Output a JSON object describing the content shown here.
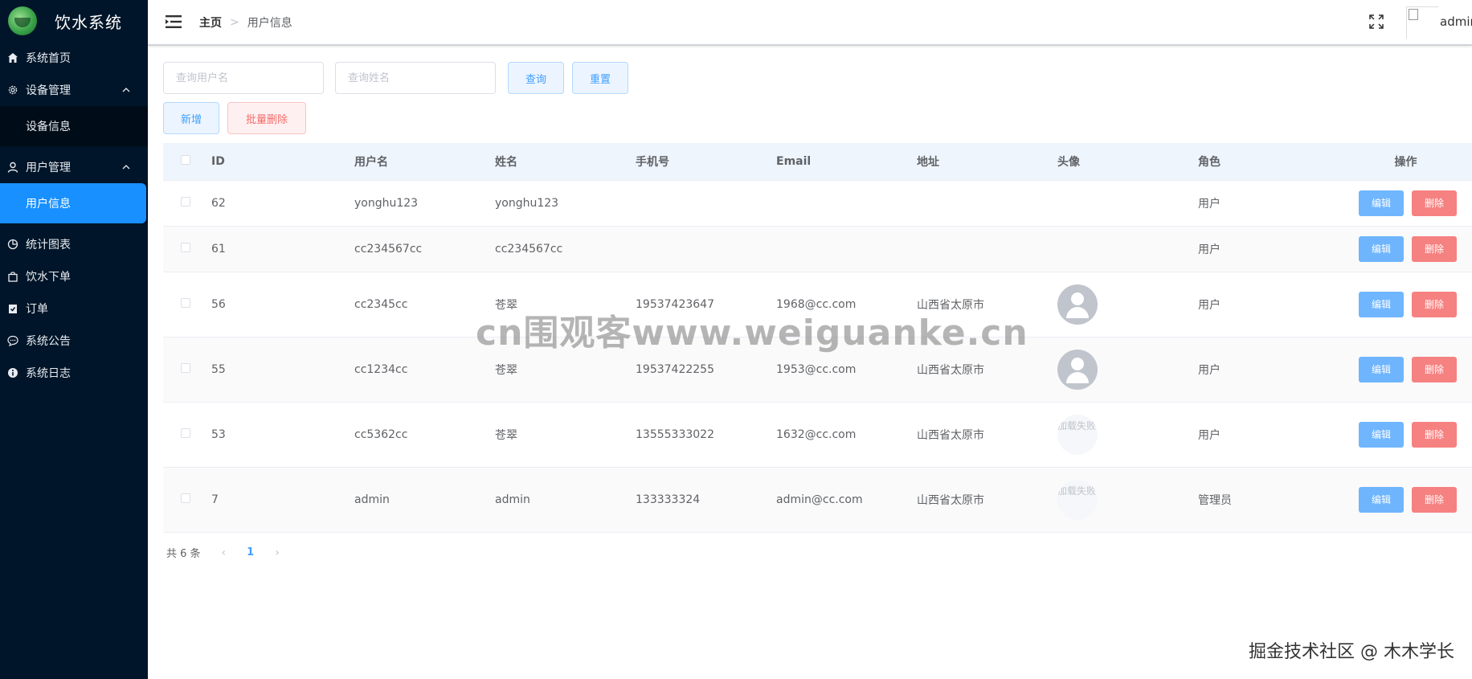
{
  "app": {
    "title": "饮水系统"
  },
  "sidebar": {
    "items": [
      {
        "label": "系统首页",
        "icon": "home-icon"
      },
      {
        "label": "设备管理",
        "icon": "gear-icon",
        "expanded": true,
        "children": [
          {
            "label": "设备信息"
          }
        ]
      },
      {
        "label": "用户管理",
        "icon": "user-icon",
        "expanded": true,
        "children": [
          {
            "label": "用户信息",
            "active": true
          }
        ]
      },
      {
        "label": "统计图表",
        "icon": "pie-chart-icon"
      },
      {
        "label": "饮水下单",
        "icon": "shopping-bag-icon"
      },
      {
        "label": "订单",
        "icon": "clipboard-check-icon"
      },
      {
        "label": "系统公告",
        "icon": "chat-bubble-icon"
      },
      {
        "label": "系统日志",
        "icon": "info-icon"
      }
    ]
  },
  "header": {
    "breadcrumb": {
      "home": "主页",
      "separator": ">",
      "current": "用户信息"
    },
    "user": "admin"
  },
  "search": {
    "username_placeholder": "查询用户名",
    "name_placeholder": "查询姓名",
    "query_label": "查询",
    "reset_label": "重置"
  },
  "actions": {
    "add_label": "新增",
    "batch_delete_label": "批量删除"
  },
  "table": {
    "columns": {
      "id": "ID",
      "username": "用户名",
      "name": "姓名",
      "phone": "手机号",
      "email": "Email",
      "address": "地址",
      "avatar": "头像",
      "role": "角色",
      "ops": "操作"
    },
    "edit_label": "编辑",
    "delete_label": "删除",
    "avatar_failed_text": "加载失败",
    "rows": [
      {
        "id": "62",
        "username": "yonghu123",
        "name": "yonghu123",
        "phone": "",
        "email": "",
        "address": "",
        "avatar": "none",
        "role": "用户"
      },
      {
        "id": "61",
        "username": "cc234567cc",
        "name": "cc234567cc",
        "phone": "",
        "email": "",
        "address": "",
        "avatar": "none",
        "role": "用户"
      },
      {
        "id": "56",
        "username": "cc2345cc",
        "name": "苍翠",
        "phone": "19537423647",
        "email": "1968@cc.com",
        "address": "山西省太原市",
        "avatar": "default",
        "role": "用户"
      },
      {
        "id": "55",
        "username": "cc1234cc",
        "name": "苍翠",
        "phone": "19537422255",
        "email": "1953@cc.com",
        "address": "山西省太原市",
        "avatar": "default",
        "role": "用户"
      },
      {
        "id": "53",
        "username": "cc5362cc",
        "name": "苍翠",
        "phone": "13555333022",
        "email": "1632@cc.com",
        "address": "山西省太原市",
        "avatar": "failed",
        "role": "用户"
      },
      {
        "id": "7",
        "username": "admin",
        "name": "admin",
        "phone": "133333324",
        "email": "admin@cc.com",
        "address": "山西省太原市",
        "avatar": "failed",
        "role": "管理员"
      }
    ]
  },
  "pagination": {
    "total_text": "共 6 条",
    "current_page": "1",
    "prev": "‹",
    "next": "›"
  },
  "overlay": {
    "watermark": "cn围观客www.weiguanke.cn",
    "corner": "掘金技术社区 @ 木木学长"
  },
  "colors": {
    "sidebar_bg": "#001529",
    "active": "#1890ff",
    "primary": "#409eff",
    "danger": "#f56c6c"
  }
}
